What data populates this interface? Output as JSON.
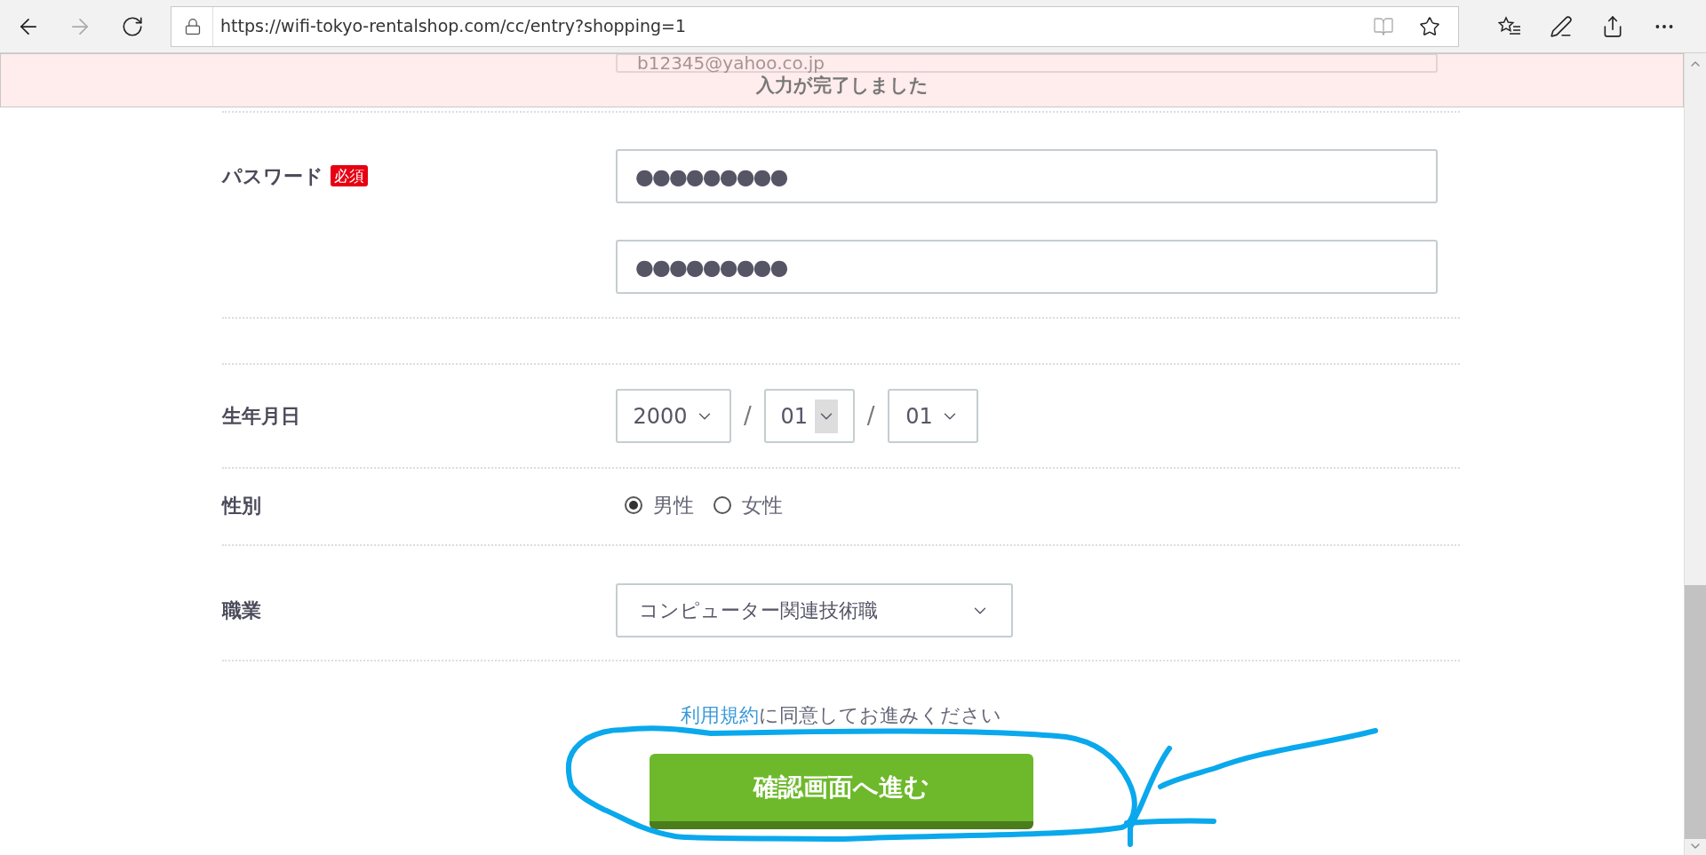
{
  "browser": {
    "url": "https://wifi-tokyo-rentalshop.com/cc/entry?shopping=1",
    "forward_disabled": true
  },
  "banner": {
    "message": "入力が完了しました"
  },
  "email": {
    "value": "b12345@yahoo.co.jp"
  },
  "password": {
    "label": "パスワード",
    "required_badge": "必須",
    "value": "●●●●●●●●●",
    "confirm_value": "●●●●●●●●●"
  },
  "birthdate": {
    "label": "生年月日",
    "year": "2000",
    "month": "01",
    "day": "01",
    "separators": [
      "/",
      "/"
    ]
  },
  "gender": {
    "label": "性別",
    "options": [
      {
        "label": "男性",
        "selected": true
      },
      {
        "label": "女性",
        "selected": false
      }
    ]
  },
  "occupation": {
    "label": "職業",
    "value": "コンピューター関連技術職"
  },
  "terms": {
    "link": "利用規約",
    "text": "に同意してお進みください"
  },
  "submit": {
    "label": "確認画面へ進む"
  }
}
